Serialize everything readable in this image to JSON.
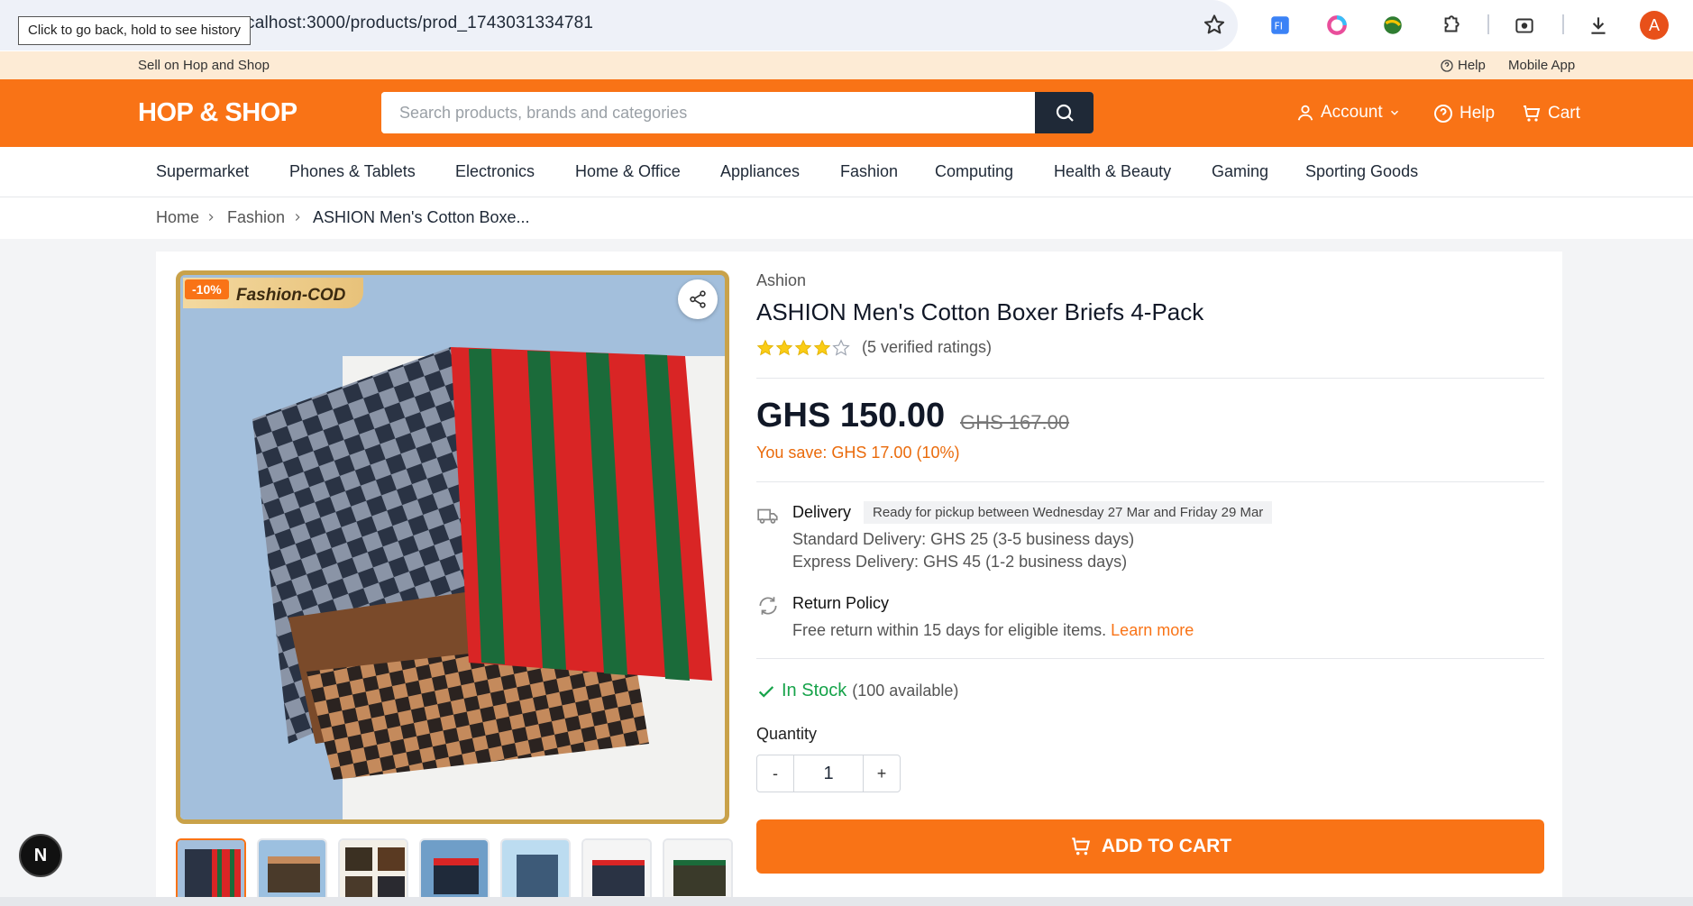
{
  "browser": {
    "url": "calhost:3000/products/prod_1743031334781",
    "tooltip": "Click to go back, hold to see history",
    "profile_initial": "A"
  },
  "top_strip": {
    "sell": "Sell on Hop and Shop",
    "help": "Help",
    "mobile_app": "Mobile App"
  },
  "header": {
    "logo": "HOP & SHOP",
    "search_placeholder": "Search products, brands and categories",
    "account": "Account",
    "help": "Help",
    "cart": "Cart"
  },
  "categories": [
    "Supermarket",
    "Phones & Tablets",
    "Electronics",
    "Home & Office",
    "Appliances",
    "Fashion",
    "Computing",
    "Health & Beauty",
    "Gaming",
    "Sporting Goods"
  ],
  "breadcrumb": [
    "Home",
    "Fashion",
    "ASHION Men's Cotton Boxe..."
  ],
  "product": {
    "discount_badge": "-10%",
    "promo_badge": "Fashion-COD",
    "brand": "Ashion",
    "title": "ASHION Men's Cotton Boxer Briefs 4-Pack",
    "rating": 4,
    "rating_max": 5,
    "rating_text": "(5 verified ratings)",
    "price": "GHS 150.00",
    "old_price": "GHS 167.00",
    "savings": "You save: GHS 17.00 (10%)",
    "thumbnail_count": 7
  },
  "delivery": {
    "label": "Delivery",
    "pickup": "Ready for pickup between Wednesday 27 Mar and Friday 29 Mar",
    "standard": "Standard Delivery: GHS 25 (3-5 business days)",
    "express": "Express Delivery: GHS 45 (1-2 business days)"
  },
  "returns": {
    "label": "Return Policy",
    "text": "Free return within 15 days for eligible items.",
    "link": "Learn more"
  },
  "stock": {
    "status": "In Stock",
    "available": "(100 available)"
  },
  "quantity": {
    "label": "Quantity",
    "value": "1",
    "minus": "-",
    "plus": "+"
  },
  "cta": {
    "add_to_cart": "ADD TO CART"
  },
  "dev_badge": "N",
  "colors": {
    "accent": "#f97316",
    "dark": "#1f2937",
    "success": "#16a34a"
  }
}
